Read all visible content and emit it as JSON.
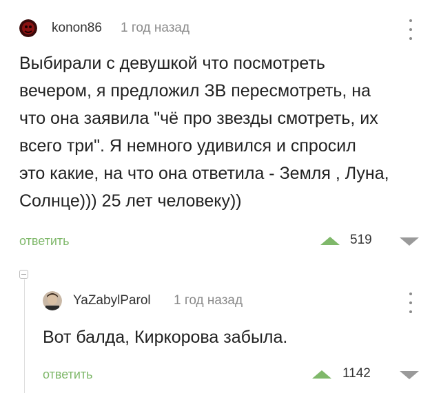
{
  "comments": [
    {
      "username": "konon86",
      "time": "1 год назад",
      "text": "Выбирали с девушкой что посмотреть\nвечером, я предложил ЗВ пересмотреть, на\nчто она заявила \"чё про звезды смотреть, их\nвсего три\". Я немного удивился и спросил\nэто какие, на что она ответила - Земля , Луна,\nСолнце))) 25 лет человеку))",
      "reply_label": "ответить",
      "rating": "519"
    },
    {
      "username": "YaZabylParol",
      "time": "1 год назад",
      "text": "Вот балда, Киркорова забыла.",
      "reply_label": "ответить",
      "rating": "1142"
    }
  ],
  "colors": {
    "accent": "#7fb86a",
    "muted": "#8a8a8a",
    "text": "#222222"
  },
  "icons": {
    "more": "more-vertical-icon",
    "upvote": "upvote-arrow-icon",
    "downvote": "downvote-arrow-icon",
    "collapse": "collapse-thread-icon"
  }
}
